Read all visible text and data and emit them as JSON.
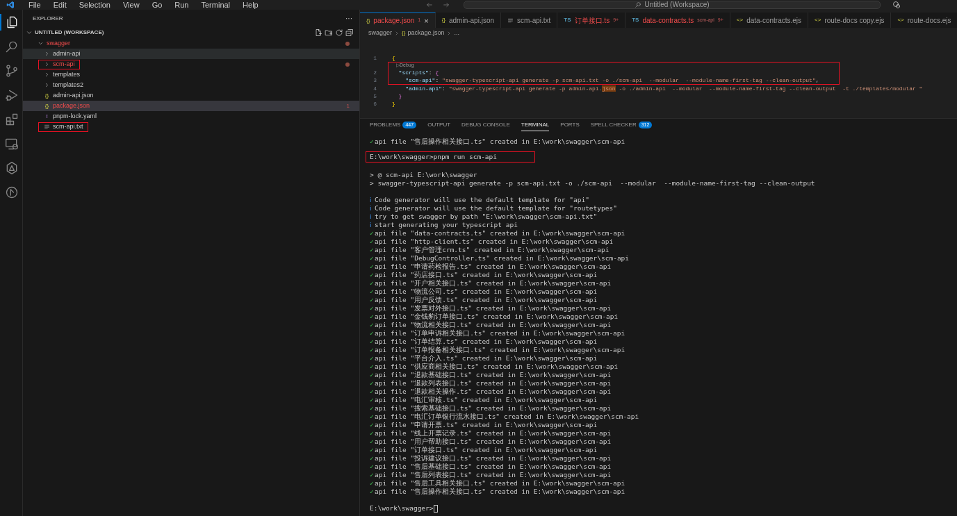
{
  "menu_bar": {
    "items": [
      "File",
      "Edit",
      "Selection",
      "View",
      "Go",
      "Run",
      "Terminal",
      "Help"
    ],
    "command_center": "Untitled (Workspace)"
  },
  "activity_bar": [
    {
      "kind": "files",
      "selected": true
    },
    {
      "kind": "search",
      "selected": false
    },
    {
      "kind": "source-control",
      "selected": false
    },
    {
      "kind": "run",
      "selected": false
    },
    {
      "kind": "extensions",
      "selected": false
    },
    {
      "kind": "remote",
      "selected": false
    },
    {
      "kind": "shape",
      "selected": false
    },
    {
      "kind": "circle",
      "selected": false
    }
  ],
  "explorer": {
    "title": "EXPLORER",
    "more": "···",
    "workspace": {
      "label": "UNTITLED (WORKSPACE)",
      "expanded": true
    },
    "tree": [
      {
        "label": "swagger",
        "kind": "folder",
        "expanded": true,
        "error": true,
        "modified": true,
        "selected": false,
        "hovered": false,
        "highlighted": false,
        "children": [
          {
            "label": "admin-api",
            "kind": "folder",
            "expanded": false,
            "error": false,
            "modified": false,
            "selected": false,
            "hovered": true,
            "highlighted": false
          },
          {
            "label": "scm-api",
            "kind": "folder",
            "expanded": false,
            "error": true,
            "modified": true,
            "selected": false,
            "hovered": false,
            "highlighted": true
          },
          {
            "label": "templates",
            "kind": "folder",
            "expanded": false,
            "error": false,
            "modified": false,
            "selected": false,
            "hovered": false,
            "highlighted": false
          },
          {
            "label": "templates2",
            "kind": "folder",
            "expanded": false,
            "error": false,
            "modified": false,
            "selected": false,
            "hovered": false,
            "highlighted": false
          },
          {
            "label": "admin-api.json",
            "kind": "json",
            "icon_label": "{}",
            "error": false,
            "modified": false,
            "selected": false,
            "hovered": false,
            "highlighted": false
          },
          {
            "label": "package.json",
            "kind": "json",
            "icon_label": "{}",
            "error": true,
            "modified": false,
            "problems": "1",
            "selected": true,
            "hovered": false,
            "highlighted": false
          },
          {
            "label": "pnpm-lock.yaml",
            "kind": "yaml",
            "icon_label": "!",
            "error": false,
            "modified": false,
            "selected": false,
            "hovered": false,
            "highlighted": false
          },
          {
            "label": "scm-api.txt",
            "kind": "txt",
            "error": false,
            "modified": false,
            "selected": false,
            "hovered": false,
            "highlighted": true
          }
        ]
      }
    ]
  },
  "tabs": [
    {
      "label": "package.json",
      "kind": "json",
      "icon_label": "{}",
      "error": true,
      "badge": "1",
      "close": "×",
      "selected": true
    },
    {
      "label": "admin-api.json",
      "kind": "json",
      "icon_label": "{}",
      "error": false,
      "selected": false
    },
    {
      "label": "scm-api.txt",
      "kind": "txt",
      "error": false,
      "selected": false
    },
    {
      "label": "订单接口.ts",
      "kind": "ts",
      "icon_label": "TS",
      "error": true,
      "badge": "9+",
      "selected": false
    },
    {
      "label": "data-contracts.ts",
      "kind": "ts",
      "icon_label": "TS",
      "error": true,
      "description": "scm-api",
      "badge": "9+",
      "selected": false
    },
    {
      "label": "data-contracts.ejs",
      "kind": "ejs",
      "icon_label": "<>",
      "error": false,
      "selected": false
    },
    {
      "label": "route-docs copy.ejs",
      "kind": "ejs",
      "icon_label": "<>",
      "error": false,
      "selected": false
    },
    {
      "label": "route-docs.ejs",
      "kind": "ejs",
      "icon_label": "<>",
      "error": false,
      "selected": false
    }
  ],
  "breadcrumb": {
    "folder": "swagger",
    "file": {
      "label": "package.json",
      "icon_label": "{}"
    },
    "more": "..."
  },
  "code": {
    "codelens": {
      "text": "▷Debug",
      "highlighted": true
    },
    "lines": [
      {
        "number": "1",
        "highlighted": false,
        "tokens": [
          {
            "kind": "brace",
            "text": "{"
          }
        ]
      },
      {
        "number": "2",
        "highlighted": true,
        "tokens": [
          {
            "kind": "key",
            "text": "  \"scripts\""
          },
          {
            "kind": "punct",
            "text": ": "
          },
          {
            "kind": "brace2",
            "text": "{"
          }
        ]
      },
      {
        "number": "3",
        "highlighted": true,
        "tokens": [
          {
            "kind": "key",
            "text": "    \"scm-api\""
          },
          {
            "kind": "punct",
            "text": ": "
          },
          {
            "kind": "string",
            "text": "\"swagger-typescript-api generate -p scm-api.txt -o ./scm-api  --modular  --module-name-first-tag --clean-output\""
          },
          {
            "kind": "punct",
            "text": ","
          }
        ]
      },
      {
        "number": "4",
        "highlighted": false,
        "tokens": [
          {
            "kind": "key",
            "text": "    \"admin-api\""
          },
          {
            "kind": "punct",
            "text": ": "
          },
          {
            "kind": "string",
            "text": "\"swagger-typescript-api generate -p admin-api."
          },
          {
            "kind": "match",
            "text": "json"
          },
          {
            "kind": "string",
            "text": " -o ./admin-api  --modular  --module-name-first-tag --clean-output  -t ./templates/modular \""
          }
        ]
      },
      {
        "number": "5",
        "highlighted": false,
        "tokens": [
          {
            "kind": "brace2",
            "text": "  }"
          }
        ]
      },
      {
        "number": "6",
        "highlighted": false,
        "tokens": [
          {
            "kind": "brace",
            "text": "}"
          }
        ]
      }
    ]
  },
  "panel_tabs": [
    {
      "label": "PROBLEMS",
      "count": "447",
      "selected": false
    },
    {
      "label": "OUTPUT",
      "selected": false
    },
    {
      "label": "DEBUG CONSOLE",
      "selected": false
    },
    {
      "label": "TERMINAL",
      "selected": true
    },
    {
      "label": "PORTS",
      "selected": false
    },
    {
      "label": "SPELL CHECKER",
      "count": "312",
      "selected": false
    }
  ],
  "terminal": [
    {
      "kind": "check",
      "mark": "✓",
      "text": "api file \"售后操作相关接口.ts\" created in E:\\work\\swagger\\scm-api"
    },
    {
      "kind": "prompt",
      "text": "E:\\work\\swagger>pnpm run scm-api",
      "space_before": true,
      "highlighted": true
    },
    {
      "kind": "plain",
      "text": "> @ scm-api E:\\work\\swagger",
      "space_before": true
    },
    {
      "kind": "plain",
      "text": "> swagger-typescript-api generate -p scm-api.txt -o ./scm-api  --modular  --module-name-first-tag --clean-output"
    },
    {
      "kind": "info",
      "mark": "ℹ",
      "text": "Code generator will use the default template for \"api\"",
      "space_before": true
    },
    {
      "kind": "info",
      "mark": "ℹ",
      "text": "Code generator will use the default template for \"routetypes\""
    },
    {
      "kind": "info",
      "mark": "ℹ",
      "text": "try to get swagger by path \"E:\\work\\swagger\\scm-api.txt\""
    },
    {
      "kind": "info",
      "mark": "ℹ",
      "text": "start generating your typescript api"
    },
    {
      "kind": "check",
      "mark": "✓",
      "text": "api file \"data-contracts.ts\" created in E:\\work\\swagger\\scm-api"
    },
    {
      "kind": "check",
      "mark": "✓",
      "text": "api file \"http-client.ts\" created in E:\\work\\swagger\\scm-api"
    },
    {
      "kind": "check",
      "mark": "✓",
      "text": "api file \"客户管理crm.ts\" created in E:\\work\\swagger\\scm-api"
    },
    {
      "kind": "check",
      "mark": "✓",
      "text": "api file \"DebugController.ts\" created in E:\\work\\swagger\\scm-api"
    },
    {
      "kind": "check",
      "mark": "✓",
      "text": "api file \"申请药检报告.ts\" created in E:\\work\\swagger\\scm-api"
    },
    {
      "kind": "check",
      "mark": "✓",
      "text": "api file \"药店接口.ts\" created in E:\\work\\swagger\\scm-api"
    },
    {
      "kind": "check",
      "mark": "✓",
      "text": "api file \"开户相关接口.ts\" created in E:\\work\\swagger\\scm-api"
    },
    {
      "kind": "check",
      "mark": "✓",
      "text": "api file \"物流公司.ts\" created in E:\\work\\swagger\\scm-api"
    },
    {
      "kind": "check",
      "mark": "✓",
      "text": "api file \"用户反馈.ts\" created in E:\\work\\swagger\\scm-api"
    },
    {
      "kind": "check",
      "mark": "✓",
      "text": "api file \"发票对外接口.ts\" created in E:\\work\\swagger\\scm-api"
    },
    {
      "kind": "check",
      "mark": "✓",
      "text": "api file \"金钱豹订单接口.ts\" created in E:\\work\\swagger\\scm-api"
    },
    {
      "kind": "check",
      "mark": "✓",
      "text": "api file \"物流相关接口.ts\" created in E:\\work\\swagger\\scm-api"
    },
    {
      "kind": "check",
      "mark": "✓",
      "text": "api file \"订单申诉相关接口.ts\" created in E:\\work\\swagger\\scm-api"
    },
    {
      "kind": "check",
      "mark": "✓",
      "text": "api file \"订单结算.ts\" created in E:\\work\\swagger\\scm-api"
    },
    {
      "kind": "check",
      "mark": "✓",
      "text": "api file \"订单报备相关接口.ts\" created in E:\\work\\swagger\\scm-api"
    },
    {
      "kind": "check",
      "mark": "✓",
      "text": "api file \"平台介入.ts\" created in E:\\work\\swagger\\scm-api"
    },
    {
      "kind": "check",
      "mark": "✓",
      "text": "api file \"供应商相关接口.ts\" created in E:\\work\\swagger\\scm-api"
    },
    {
      "kind": "check",
      "mark": "✓",
      "text": "api file \"退款基础接口.ts\" created in E:\\work\\swagger\\scm-api"
    },
    {
      "kind": "check",
      "mark": "✓",
      "text": "api file \"退款列表接口.ts\" created in E:\\work\\swagger\\scm-api"
    },
    {
      "kind": "check",
      "mark": "✓",
      "text": "api file \"退款相关操作.ts\" created in E:\\work\\swagger\\scm-api"
    },
    {
      "kind": "check",
      "mark": "✓",
      "text": "api file \"电汇审核.ts\" created in E:\\work\\swagger\\scm-api"
    },
    {
      "kind": "check",
      "mark": "✓",
      "text": "api file \"搜索基础接口.ts\" created in E:\\work\\swagger\\scm-api"
    },
    {
      "kind": "check",
      "mark": "✓",
      "text": "api file \"电汇订单银行流水接口.ts\" created in E:\\work\\swagger\\scm-api"
    },
    {
      "kind": "check",
      "mark": "✓",
      "text": "api file \"申请开票.ts\" created in E:\\work\\swagger\\scm-api"
    },
    {
      "kind": "check",
      "mark": "✓",
      "text": "api file \"线上开票记录.ts\" created in E:\\work\\swagger\\scm-api"
    },
    {
      "kind": "check",
      "mark": "✓",
      "text": "api file \"用户帮助接口.ts\" created in E:\\work\\swagger\\scm-api"
    },
    {
      "kind": "check",
      "mark": "✓",
      "text": "api file \"订单接口.ts\" created in E:\\work\\swagger\\scm-api"
    },
    {
      "kind": "check",
      "mark": "✓",
      "text": "api file \"投诉建议接口.ts\" created in E:\\work\\swagger\\scm-api"
    },
    {
      "kind": "check",
      "mark": "✓",
      "text": "api file \"售后基础接口.ts\" created in E:\\work\\swagger\\scm-api"
    },
    {
      "kind": "check",
      "mark": "✓",
      "text": "api file \"售后列表接口.ts\" created in E:\\work\\swagger\\scm-api"
    },
    {
      "kind": "check",
      "mark": "✓",
      "text": "api file \"售后工具相关接口.ts\" created in E:\\work\\swagger\\scm-api"
    },
    {
      "kind": "check",
      "mark": "✓",
      "text": "api file \"售后操作相关接口.ts\" created in E:\\work\\swagger\\scm-api"
    },
    {
      "kind": "prompt",
      "text": "E:\\work\\swagger>",
      "space_before": true,
      "cursor": true
    }
  ]
}
